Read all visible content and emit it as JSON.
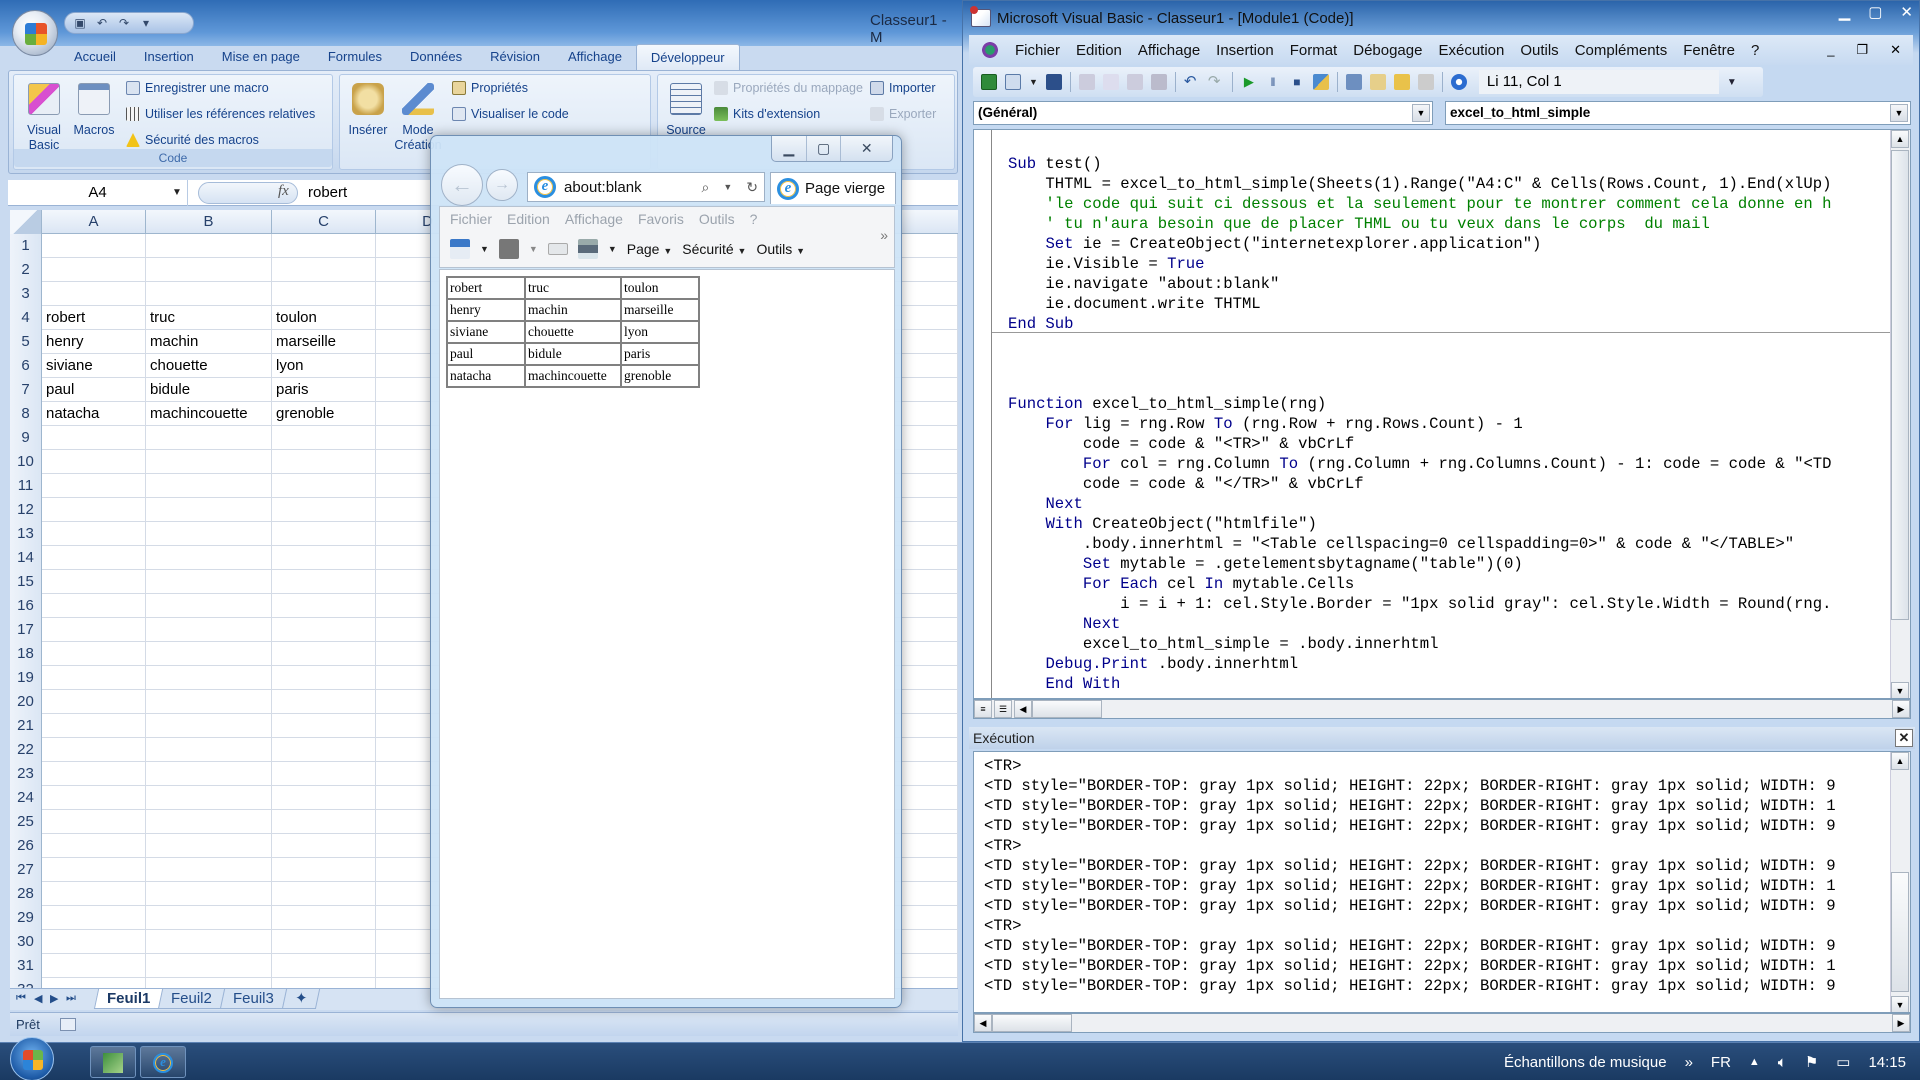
{
  "excel": {
    "title": "Classeur1 - M",
    "quick_access": [
      "save-icon",
      "undo-icon",
      "redo-icon",
      "customize-icon"
    ],
    "ribbon_tabs": [
      "Accueil",
      "Insertion",
      "Mise en page",
      "Formules",
      "Données",
      "Révision",
      "Affichage",
      "Développeur"
    ],
    "active_tab": "Développeur",
    "code_group": {
      "label": "Code",
      "visual_basic": "Visual Basic",
      "macros": "Macros",
      "record_macro": "Enregistrer une macro",
      "relative_refs": "Utiliser les références relatives",
      "macro_security": "Sécurité des macros"
    },
    "controls_group": {
      "insert": "Insérer",
      "design_mode": "Mode Création",
      "properties": "Propriétés",
      "view_code": "Visualiser le code"
    },
    "xml_group": {
      "source": "Source",
      "map_properties": "Propriétés du mappage",
      "extension_packs": "Kits d'extension",
      "import": "Importer",
      "export": "Exporter"
    },
    "name_box": "A4",
    "fx_label": "fx",
    "formula_value": "robert",
    "columns": [
      "A",
      "B",
      "C",
      "D"
    ],
    "row_numbers": [
      "1",
      "2",
      "3",
      "4",
      "5",
      "6",
      "7",
      "8",
      "9",
      "10",
      "11",
      "12",
      "13",
      "14",
      "15",
      "16",
      "17",
      "18",
      "19",
      "20",
      "21",
      "22",
      "23",
      "24",
      "25",
      "26",
      "27",
      "28",
      "29",
      "30",
      "31",
      "32"
    ],
    "cells": {
      "4": [
        "robert",
        "truc",
        "toulon"
      ],
      "5": [
        "henry",
        "machin",
        "marseille"
      ],
      "6": [
        "siviane",
        "chouette",
        "lyon"
      ],
      "7": [
        "paul",
        "bidule",
        "paris"
      ],
      "8": [
        "natacha",
        "machincouette",
        "grenoble"
      ]
    },
    "sheet_tabs": [
      "Feuil1",
      "Feuil2",
      "Feuil3"
    ],
    "active_sheet": "Feuil1",
    "status": "Prêt"
  },
  "ie": {
    "address": "about:blank",
    "tab_title": "Page vierge",
    "menu": [
      "Fichier",
      "Edition",
      "Affichage",
      "Favoris",
      "Outils",
      "?"
    ],
    "toolbar": {
      "page": "Page",
      "security": "Sécurité",
      "tools": "Outils"
    },
    "table": [
      [
        "robert",
        "truc",
        "toulon"
      ],
      [
        "henry",
        "machin",
        "marseille"
      ],
      [
        "siviane",
        "chouette",
        "lyon"
      ],
      [
        "paul",
        "bidule",
        "paris"
      ],
      [
        "natacha",
        "machincouette",
        "grenoble"
      ]
    ]
  },
  "vba": {
    "title": "Microsoft Visual Basic - Classeur1 - [Module1 (Code)]",
    "menu": [
      "Fichier",
      "Edition",
      "Affichage",
      "Insertion",
      "Format",
      "Débogage",
      "Exécution",
      "Outils",
      "Compléments",
      "Fenêtre",
      "?"
    ],
    "cursor_position": "Li 11, Col 1",
    "object_combo": "(Général)",
    "procedure_combo": "excel_to_html_simple",
    "code_lines": [
      {
        "t": "Sub test()",
        "k": "sub"
      },
      {
        "t": "    THTML = excel_to_html_simple(Sheets(1).Range(\"A4:C\" & Cells(Rows.Count, 1).End(xlUp)",
        "k": ""
      },
      {
        "t": "    'le code qui suit ci dessous et la seulement pour te montrer comment cela donne en h",
        "k": "comment"
      },
      {
        "t": "    ' tu n'aura besoin que de placer THML ou tu veux dans le corps  du mail",
        "k": "comment"
      },
      {
        "t": "    Set ie = CreateObject(\"internetexplorer.application\")",
        "k": "set"
      },
      {
        "t": "    ie.Visible = True",
        "k": "true"
      },
      {
        "t": "    ie.navigate \"about:blank\"",
        "k": ""
      },
      {
        "t": "    ie.document.write THTML",
        "k": ""
      },
      {
        "t": "End Sub",
        "k": "endsub"
      },
      {
        "t": "",
        "k": ""
      },
      {
        "t": "",
        "k": ""
      },
      {
        "t": "",
        "k": ""
      },
      {
        "t": "Function excel_to_html_simple(rng)",
        "k": "function"
      },
      {
        "t": "    For lig = rng.Row To (rng.Row + rng.Rows.Count) - 1",
        "k": "for"
      },
      {
        "t": "        code = code & \"<TR>\" & vbCrLf",
        "k": ""
      },
      {
        "t": "        For col = rng.Column To (rng.Column + rng.Columns.Count) - 1: code = code & \"<TD",
        "k": "for"
      },
      {
        "t": "        code = code & \"</TR>\" & vbCrLf",
        "k": ""
      },
      {
        "t": "    Next",
        "k": "next"
      },
      {
        "t": "    With CreateObject(\"htmlfile\")",
        "k": "with"
      },
      {
        "t": "        .body.innerhtml = \"<Table cellspacing=0 cellspadding=0>\" & code & \"</TABLE>\"",
        "k": ""
      },
      {
        "t": "        Set mytable = .getelementsbytagname(\"table\")(0)",
        "k": "set"
      },
      {
        "t": "        For Each cel In mytable.Cells",
        "k": "foreach"
      },
      {
        "t": "            i = i + 1: cel.Style.Border = \"1px solid gray\": cel.Style.Width = Round(rng.",
        "k": ""
      },
      {
        "t": "        Next",
        "k": "next"
      },
      {
        "t": "        excel_to_html_simple = .body.innerhtml",
        "k": ""
      },
      {
        "t": "    Debug.Print .body.innerhtml",
        "k": "debug"
      },
      {
        "t": "    End With",
        "k": "endwith"
      }
    ],
    "immediate_title": "Exécution",
    "immediate_lines": [
      "<TR>",
      "<TD style=\"BORDER-TOP: gray 1px solid; HEIGHT: 22px; BORDER-RIGHT: gray 1px solid; WIDTH: 9",
      "<TD style=\"BORDER-TOP: gray 1px solid; HEIGHT: 22px; BORDER-RIGHT: gray 1px solid; WIDTH: 1",
      "<TD style=\"BORDER-TOP: gray 1px solid; HEIGHT: 22px; BORDER-RIGHT: gray 1px solid; WIDTH: 9",
      "<TR>",
      "<TD style=\"BORDER-TOP: gray 1px solid; HEIGHT: 22px; BORDER-RIGHT: gray 1px solid; WIDTH: 9",
      "<TD style=\"BORDER-TOP: gray 1px solid; HEIGHT: 22px; BORDER-RIGHT: gray 1px solid; WIDTH: 1",
      "<TD style=\"BORDER-TOP: gray 1px solid; HEIGHT: 22px; BORDER-RIGHT: gray 1px solid; WIDTH: 9",
      "<TR>",
      "<TD style=\"BORDER-TOP: gray 1px solid; HEIGHT: 22px; BORDER-RIGHT: gray 1px solid; WIDTH: 9",
      "<TD style=\"BORDER-TOP: gray 1px solid; HEIGHT: 22px; BORDER-RIGHT: gray 1px solid; WIDTH: 1",
      "<TD style=\"BORDER-TOP: gray 1px solid; HEIGHT: 22px; BORDER-RIGHT: gray 1px solid; WIDTH: 9"
    ]
  },
  "taskbar": {
    "toolbar_label": "Échantillons de musique",
    "language": "FR",
    "clock": "14:15"
  },
  "colors": {
    "code_keyword": "#00008b",
    "code_comment": "#008000",
    "ribbon_text": "#15428b"
  }
}
